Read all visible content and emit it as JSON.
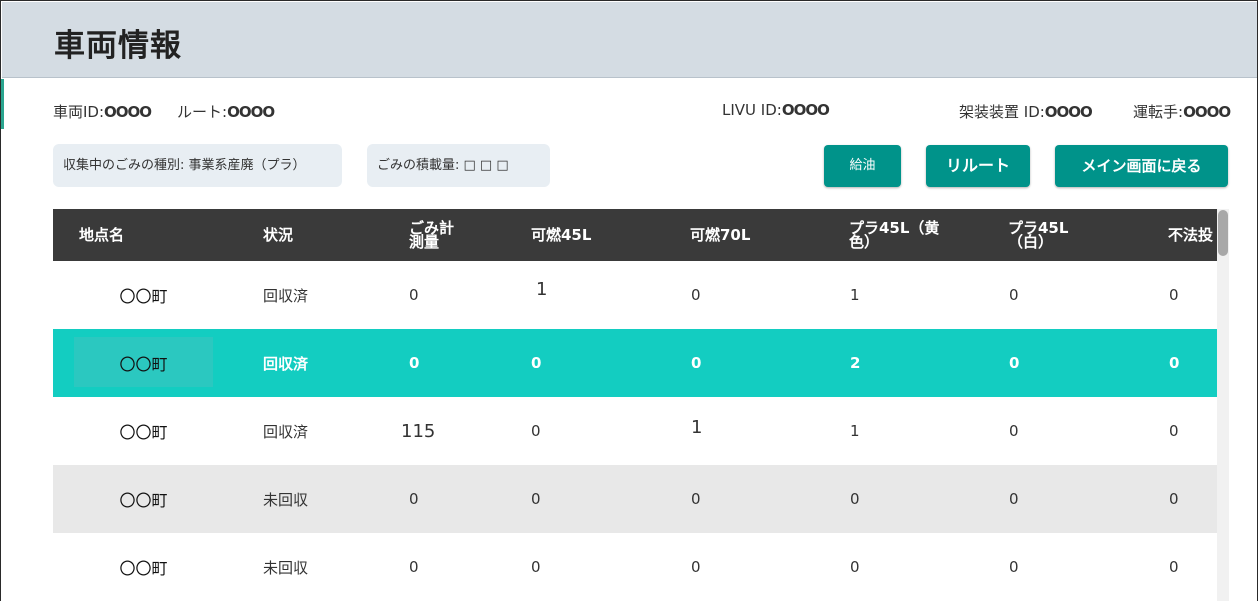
{
  "header": {
    "title": "車両情報"
  },
  "info": {
    "vehicle_id_label": "車両ID:",
    "vehicle_id_value": "OOOO",
    "route_label": "ルート:",
    "route_value": "OOOO",
    "livu_label": "LIVU ID:",
    "livu_value": "OOOO",
    "device_label": "架装装置 ID:",
    "device_value": "OOOO",
    "driver_label": "運転手:",
    "driver_value": "OOOO"
  },
  "chips": {
    "garbage_type": "収集中のごみの種別: 事業系産廃（プラ）",
    "load_label": "ごみの積載量: □ □ □"
  },
  "buttons": {
    "refuel": "給油",
    "reroute": "リルート",
    "back_main": "メイン画面に戻る"
  },
  "table": {
    "headers": [
      "地点名",
      "状況",
      "ごみ計\n測量",
      "可燃45L",
      "可燃70L",
      "プラ45L（黄\n色）",
      "プラ45L\n（白）",
      "不法投"
    ],
    "rows": [
      [
        "〇〇町",
        "回収済",
        "0",
        "1",
        "0",
        "1",
        "0",
        "0"
      ],
      [
        "〇〇町",
        "回収済",
        "0",
        "0",
        "0",
        "2",
        "0",
        "0"
      ],
      [
        "〇〇町",
        "回収済",
        "115",
        "0",
        "1",
        "1",
        "0",
        "0"
      ],
      [
        "〇〇町",
        "未回収",
        "0",
        "0",
        "0",
        "0",
        "0",
        "0"
      ],
      [
        "〇〇町",
        "未回収",
        "0",
        "0",
        "0",
        "0",
        "0",
        "0"
      ]
    ]
  },
  "colors": {
    "accent": "#00938a",
    "selected_row": "#13cdc1",
    "header_bg": "#d4dce3",
    "table_head": "#3a3a3a"
  }
}
